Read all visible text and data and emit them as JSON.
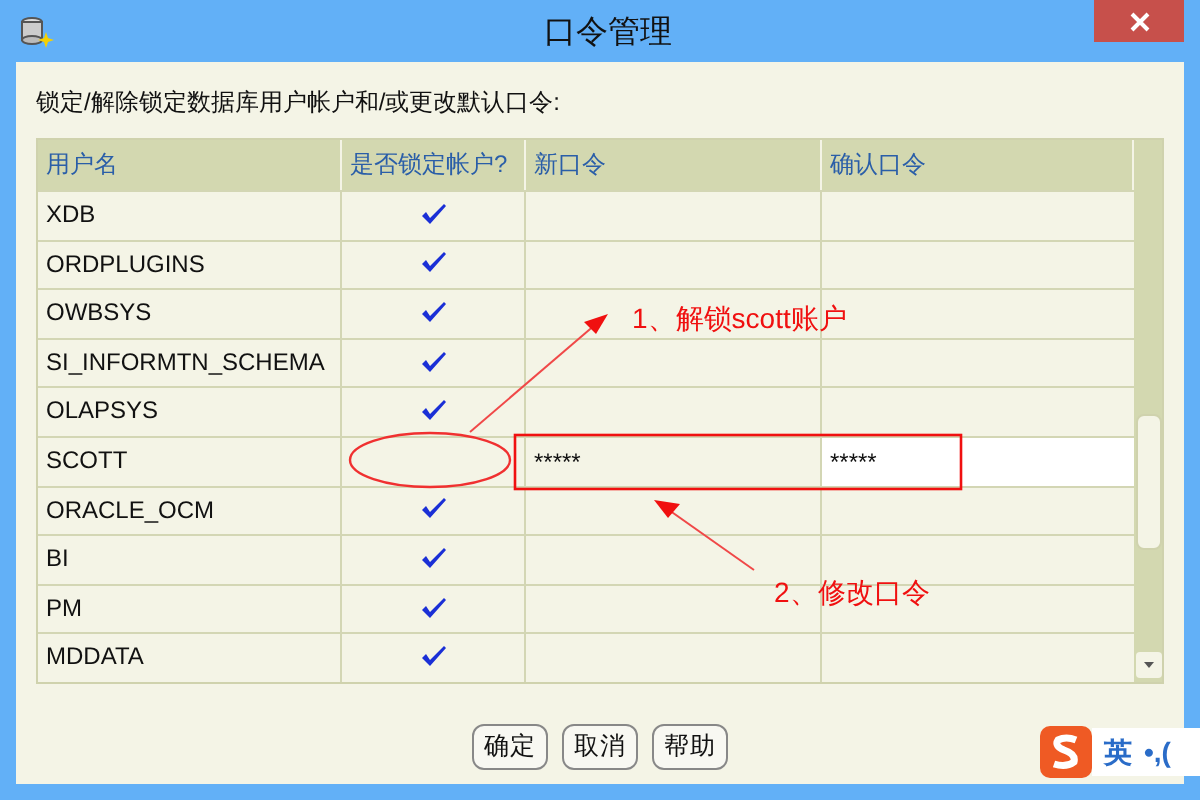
{
  "window": {
    "title": "口令管理"
  },
  "instruction": "锁定/解除锁定数据库用户帐户和/或更改默认口令:",
  "table": {
    "columns": [
      "用户名",
      "是否锁定帐户?",
      "新口令",
      "确认口令"
    ],
    "rows": [
      {
        "user": "XDB",
        "locked": true
      },
      {
        "user": "ORDPLUGINS",
        "locked": true
      },
      {
        "user": "OWBSYS",
        "locked": true
      },
      {
        "user": "SI_INFORMTN_SCHEMA",
        "locked": true
      },
      {
        "user": "OLAPSYS",
        "locked": true
      },
      {
        "user": "SCOTT",
        "locked": false,
        "new_password": "*****",
        "confirm_password": "*****",
        "selected": true
      },
      {
        "user": "ORACLE_OCM",
        "locked": true
      },
      {
        "user": "BI",
        "locked": true
      },
      {
        "user": "PM",
        "locked": true
      },
      {
        "user": "MDDATA",
        "locked": true
      }
    ]
  },
  "buttons": [
    "确定",
    "取消",
    "帮助"
  ],
  "annotations": [
    {
      "text": "1、解锁scott账户"
    },
    {
      "text": "2、修改口令"
    }
  ],
  "ime_toolbar": {
    "mode": "英",
    "punctuation": "•,("
  }
}
